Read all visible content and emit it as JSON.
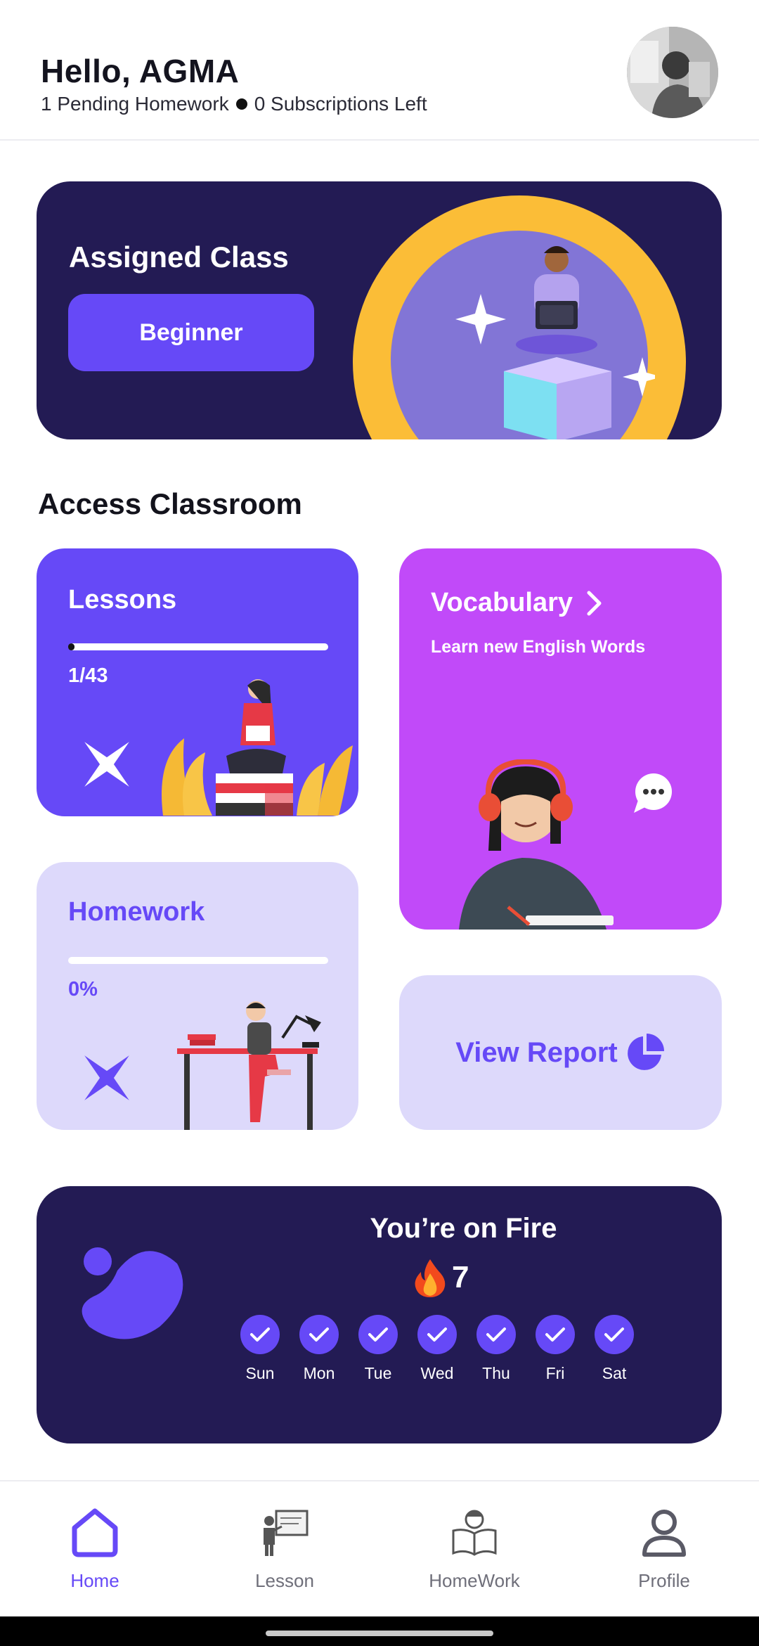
{
  "header": {
    "greeting": "Hello, AGMA",
    "pending": "1 Pending Homework",
    "subscriptions": "0 Subscriptions Left"
  },
  "assigned_class": {
    "title": "Assigned Class",
    "level": "Beginner"
  },
  "section_title": "Access Classroom",
  "lessons": {
    "title": "Lessons",
    "progress_text": "1/43",
    "progress_fraction": 0.023
  },
  "vocabulary": {
    "title": "Vocabulary",
    "subtitle": "Learn new English Words"
  },
  "homework": {
    "title": "Homework",
    "progress_text": "0%",
    "progress_fraction": 0
  },
  "report": {
    "label": "View Report"
  },
  "streak": {
    "title": "You’re on Fire",
    "count": "7",
    "days": [
      "Sun",
      "Mon",
      "Tue",
      "Wed",
      "Thu",
      "Fri",
      "Sat"
    ]
  },
  "nav": {
    "items": [
      {
        "label": "Home",
        "icon": "home-icon",
        "active": true
      },
      {
        "label": "Lesson",
        "icon": "teacher-board-icon",
        "active": false
      },
      {
        "label": "HomeWork",
        "icon": "reading-student-icon",
        "active": false
      },
      {
        "label": "Profile",
        "icon": "user-icon",
        "active": false
      }
    ]
  },
  "colors": {
    "primary": "#6649f7",
    "navy": "#231b54",
    "vocab": "#c14af9",
    "light": "#ddd9fb",
    "accent_yellow": "#fbbd37"
  }
}
